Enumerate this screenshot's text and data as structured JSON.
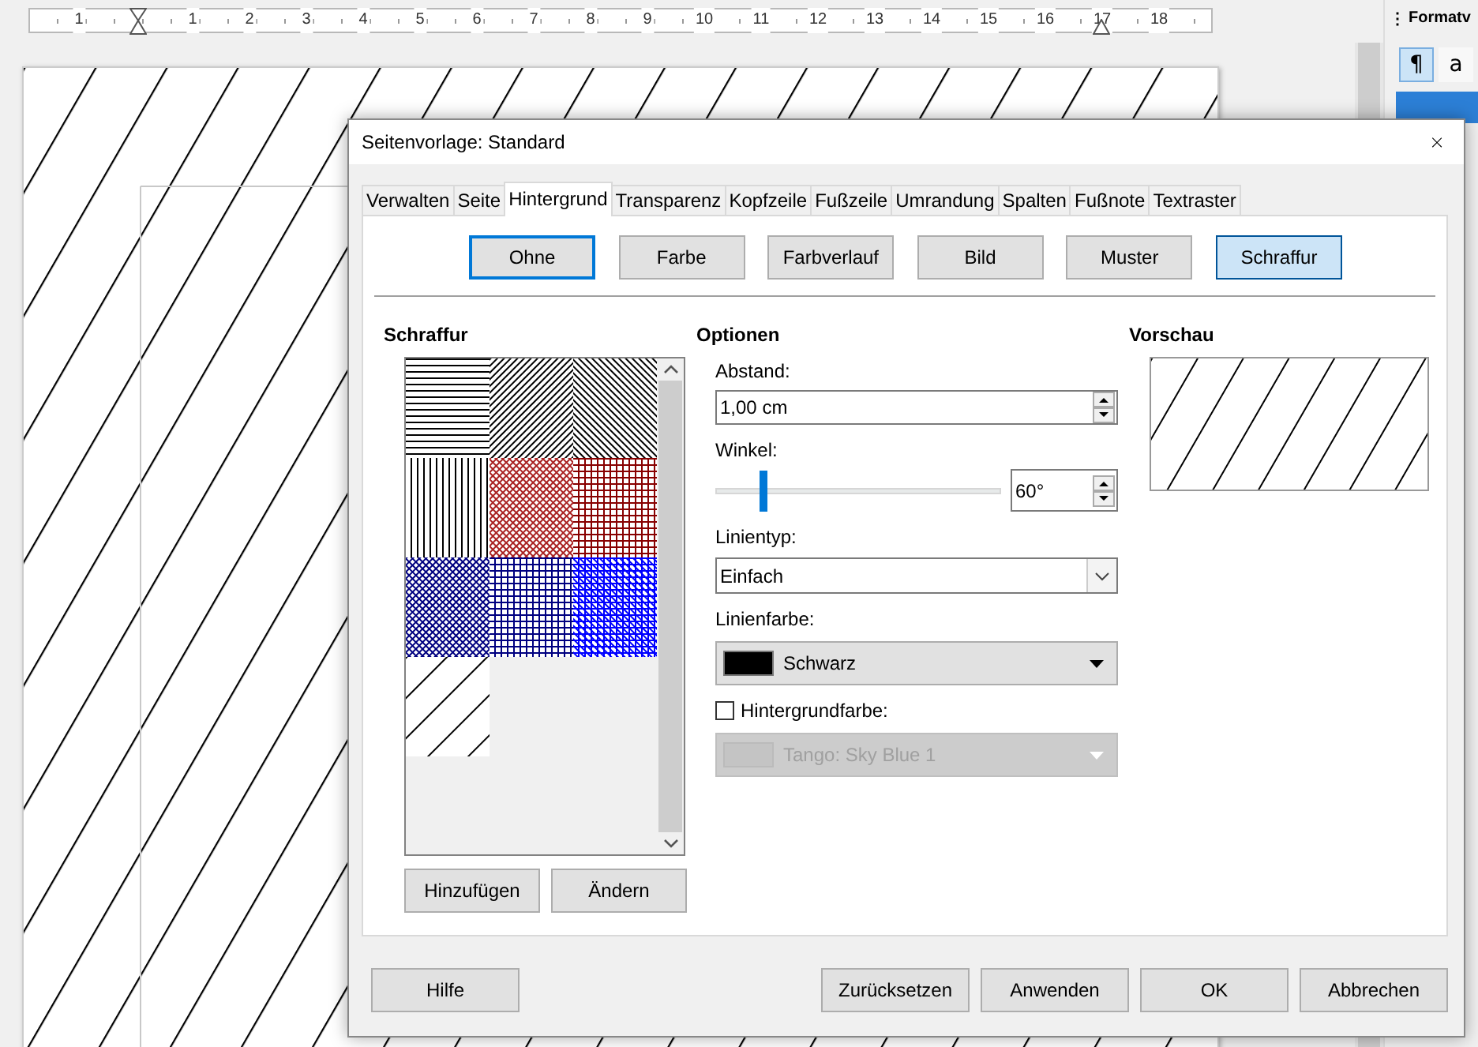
{
  "ruler": {
    "labels": [
      "1",
      "1",
      "2",
      "3",
      "4",
      "5",
      "6",
      "7",
      "8",
      "9",
      "10",
      "11",
      "12",
      "13",
      "14",
      "15",
      "16",
      "17",
      "18"
    ]
  },
  "sidebar": {
    "menu_glyph": "⋮",
    "title": "Formatv",
    "buttons": [
      {
        "label": "¶",
        "selected": true
      },
      {
        "label": "a",
        "selected": false
      }
    ]
  },
  "dialog": {
    "title": "Seitenvorlage: Standard",
    "close": "×",
    "tabs": [
      {
        "label": "Verwalten",
        "selected": false
      },
      {
        "label": "Seite",
        "selected": false
      },
      {
        "label": "Hintergrund",
        "selected": true
      },
      {
        "label": "Transparenz",
        "selected": false
      },
      {
        "label": "Kopfzeile",
        "selected": false
      },
      {
        "label": "Fußzeile",
        "selected": false
      },
      {
        "label": "Umrandung",
        "selected": false
      },
      {
        "label": "Spalten",
        "selected": false
      },
      {
        "label": "Fußnote",
        "selected": false
      },
      {
        "label": "Textraster",
        "selected": false
      }
    ],
    "fill_buttons": [
      {
        "label": "Ohne",
        "selected": false,
        "focused": true
      },
      {
        "label": "Farbe",
        "selected": false,
        "focused": false
      },
      {
        "label": "Farbverlauf",
        "selected": false,
        "focused": false
      },
      {
        "label": "Bild",
        "selected": false,
        "focused": false
      },
      {
        "label": "Muster",
        "selected": false,
        "focused": false
      },
      {
        "label": "Schraffur",
        "selected": true,
        "focused": false
      }
    ],
    "hatch": {
      "heading": "Schraffur",
      "items": [
        {
          "kind": "horizontal",
          "color": "#000000"
        },
        {
          "kind": "diagonal-up",
          "color": "#000000"
        },
        {
          "kind": "diagonal-down",
          "color": "#000000"
        },
        {
          "kind": "vertical",
          "color": "#000000"
        },
        {
          "kind": "cross-diagonal",
          "color": "#aa2222"
        },
        {
          "kind": "grid",
          "color": "#880000"
        },
        {
          "kind": "cross-diagonal",
          "color": "#000080"
        },
        {
          "kind": "grid",
          "color": "#000080"
        },
        {
          "kind": "grid-diagonal",
          "color": "#0000ff"
        },
        {
          "kind": "wide-diagonal",
          "color": "#000000"
        }
      ],
      "buttons": [
        "Hinzufügen",
        "Ändern"
      ]
    },
    "options": {
      "heading": "Optionen",
      "spacing": {
        "label": "Abstand:",
        "value": "1,00 cm"
      },
      "angle": {
        "label": "Winkel:",
        "level": 0.17,
        "value": "60°"
      },
      "line_type": {
        "label": "Linientyp:",
        "value": "Einfach"
      },
      "line_color": {
        "label": "Linienfarbe:",
        "value": "Schwarz",
        "color": "#000000"
      },
      "background_color": {
        "label": "Hintergrundfarbe:",
        "checked": false,
        "value": "Tango: Sky Blue 1",
        "disabled": true
      }
    },
    "preview": {
      "heading": "Vorschau"
    },
    "footer_buttons": [
      {
        "label": "Hilfe",
        "kind": "left"
      },
      {
        "label": "Zurücksetzen",
        "kind": "right"
      },
      {
        "label": "Anwenden",
        "kind": "right"
      },
      {
        "label": "OK",
        "kind": "right"
      },
      {
        "label": "Abbrechen",
        "kind": "right"
      }
    ]
  }
}
